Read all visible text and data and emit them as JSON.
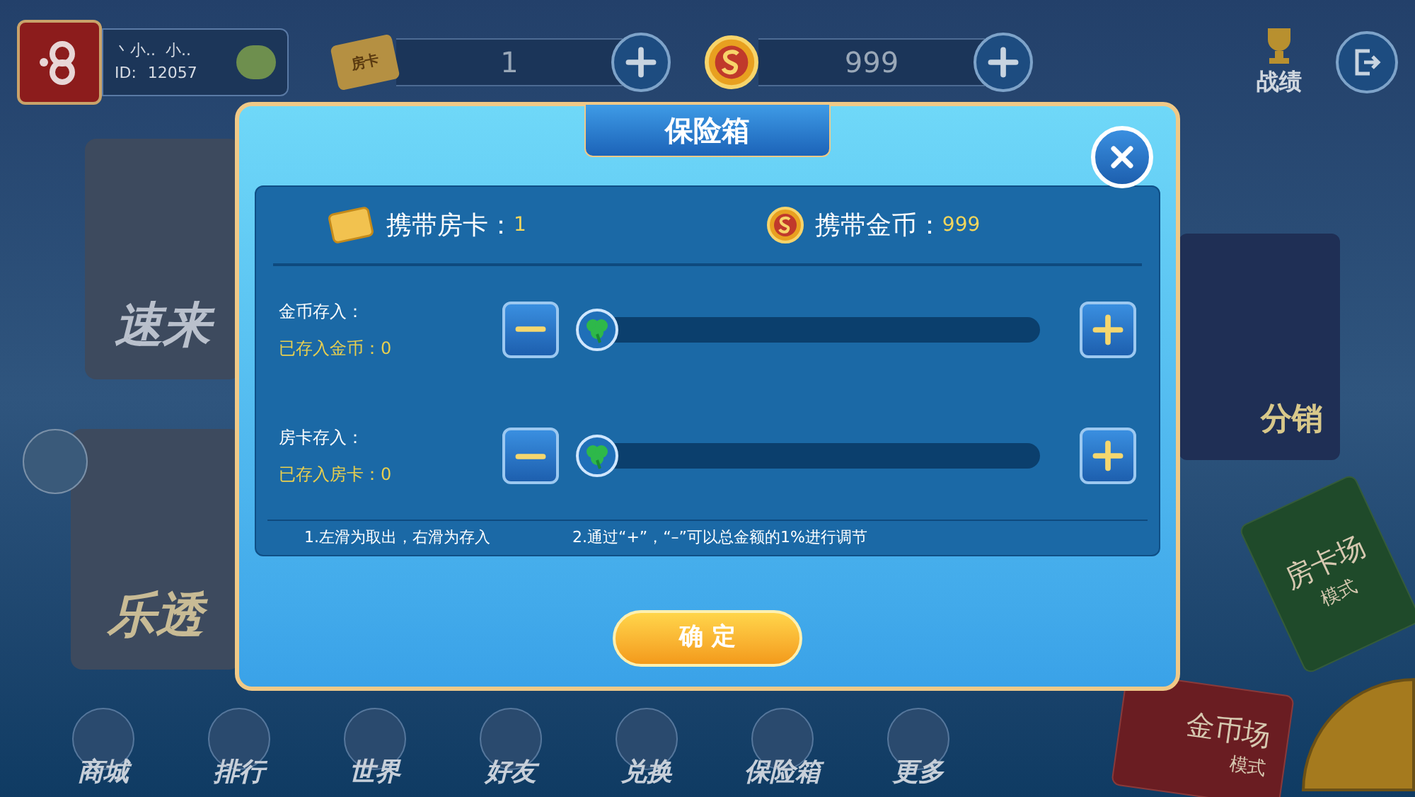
{
  "top_bar": {
    "player": {
      "name": "丶小..  小..",
      "id_label": "ID:",
      "id": "12057"
    },
    "room_cards": {
      "icon_label": "房卡",
      "value": "1"
    },
    "coins": {
      "value": "999"
    },
    "records_label": "战绩"
  },
  "lobby": {
    "games": [
      {
        "title": "速来"
      },
      {
        "title": "乐透"
      }
    ],
    "promo": {
      "title": "分销"
    },
    "modes": [
      {
        "kind": "card",
        "title": "房卡场",
        "subtitle": "模式"
      },
      {
        "kind": "coin",
        "title": "金币场",
        "subtitle": "模式"
      }
    ]
  },
  "bottom_nav": [
    {
      "label": "商城"
    },
    {
      "label": "排行"
    },
    {
      "label": "世界"
    },
    {
      "label": "好友"
    },
    {
      "label": "兑换"
    },
    {
      "label": "保险箱"
    },
    {
      "label": "更多"
    }
  ],
  "dialog": {
    "title": "保险箱",
    "carry": [
      {
        "kind": "card",
        "label": "携带房卡：",
        "value": "1"
      },
      {
        "kind": "coin",
        "label": "携带金币：",
        "value": "999"
      }
    ],
    "deposits": [
      {
        "label": "金币存入：",
        "stored": "已存入金币：0",
        "level": 0
      },
      {
        "label": "房卡存入：",
        "stored": "已存入房卡：0",
        "level": 0
      }
    ],
    "notes": [
      "1.左滑为取出，右滑为存入",
      "2.通过“+”，“–”可以总金额的1%进行调节"
    ],
    "confirm": "确 定"
  }
}
